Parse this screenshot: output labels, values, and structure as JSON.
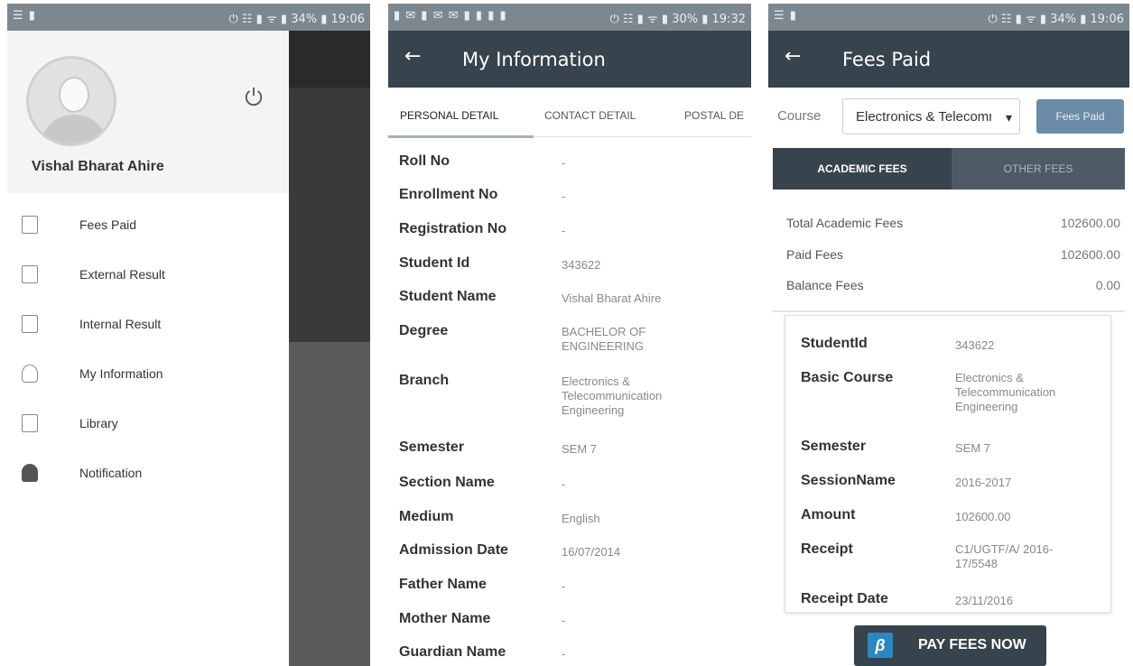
{
  "status_bar": {
    "s1": {
      "left": "☰ ▮",
      "right": "⏻ ☷ ▮ ᯤ ▮ 34% ▮ 19:06"
    },
    "s2": {
      "left": "▮ ✉ ▮ ✉ ✉ ▮ ▮ ▮ ▮",
      "right": "⏻ ☷ ▮ ᯤ ▮ 30% ▮ 19:32"
    },
    "s3": {
      "left": "☰ ▮",
      "right": "⏻ ☷ ▮ ᯤ ▮ 34% ▮ 19:06"
    }
  },
  "drawer": {
    "user_name": "Vishal Bharat Ahire",
    "items": [
      {
        "label": "Fees Paid",
        "icon": "fees-paid-icon"
      },
      {
        "label": "External Result",
        "icon": "external-result-icon"
      },
      {
        "label": "Internal Result",
        "icon": "internal-result-icon"
      },
      {
        "label": "My Information",
        "icon": "user-icon"
      },
      {
        "label": "Library",
        "icon": "library-icon"
      },
      {
        "label": "Notification",
        "icon": "bell-icon"
      }
    ]
  },
  "my_info": {
    "title": "My Information",
    "tabs": [
      "PERSONAL DETAIL",
      "CONTACT DETAIL",
      "POSTAL DE"
    ],
    "fields": [
      {
        "label": "Roll No",
        "value": "-"
      },
      {
        "label": "Enrollment No",
        "value": "-"
      },
      {
        "label": "Registration No",
        "value": "-"
      },
      {
        "label": "Student Id",
        "value": "343622"
      },
      {
        "label": "Student Name",
        "value": "Vishal Bharat Ahire"
      },
      {
        "label": "Degree",
        "value": "BACHELOR OF ENGINEERING"
      },
      {
        "label": "Branch",
        "value": "Electronics & Telecommunication Engineering"
      },
      {
        "label": "Semester",
        "value": "SEM 7"
      },
      {
        "label": "Section Name",
        "value": "-"
      },
      {
        "label": "Medium",
        "value": "English"
      },
      {
        "label": "Admission Date",
        "value": "16/07/2014"
      },
      {
        "label": "Father Name",
        "value": "-"
      },
      {
        "label": "Mother Name",
        "value": "-"
      },
      {
        "label": "Guardian Name",
        "value": "-"
      }
    ]
  },
  "fees": {
    "title": "Fees Paid",
    "course_label": "Course",
    "course_value": "Electronics & Telecommunication",
    "fees_paid_button": "Fees Paid",
    "tab_academic": "ACADEMIC FEES",
    "tab_other": "OTHER FEES",
    "summary": [
      {
        "label": "Total Academic Fees",
        "value": "102600.00"
      },
      {
        "label": "Paid Fees",
        "value": "102600.00"
      },
      {
        "label": "Balance Fees",
        "value": "0.00"
      }
    ],
    "card": [
      {
        "label": "StudentId",
        "value": "343622"
      },
      {
        "label": "Basic Course",
        "value": "Electronics & Telecommunication Engineering"
      },
      {
        "label": "Semester",
        "value": "SEM 7"
      },
      {
        "label": "SessionName",
        "value": "2016-2017"
      },
      {
        "label": "Amount",
        "value": "102600.00"
      },
      {
        "label": "Receipt",
        "value": "C1/UGTF/A/ 2016-17/5548"
      },
      {
        "label": "Receipt Date",
        "value": "23/11/2016"
      }
    ],
    "pay_button": "PAY FEES NOW"
  }
}
